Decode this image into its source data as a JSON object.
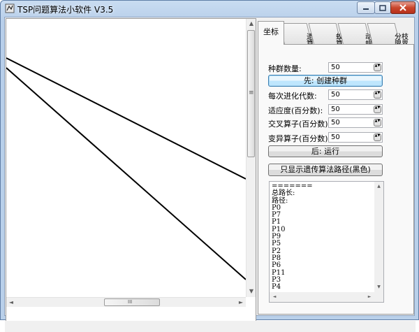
{
  "window": {
    "title": "TSP问题算法小软件 V3.5",
    "icons": {
      "app": "app-icon",
      "minimize": "minimize-icon",
      "maximize": "maximize-icon",
      "close": "close-icon"
    }
  },
  "canvas": {
    "scroll": {
      "up": "▲",
      "down": "▼",
      "left": "◄",
      "right": "►",
      "vgrip": "≡",
      "hgrip": "III"
    }
  },
  "tabs": [
    {
      "label": "坐标",
      "active": true
    },
    {
      "label": "遗传\n算法",
      "active": false
    },
    {
      "label": "蚁群\n算法",
      "active": false
    },
    {
      "label": "动态\n规划",
      "active": false
    },
    {
      "label": "分枝\n限界",
      "active": false
    }
  ],
  "ga": {
    "population_label": "种群数量:",
    "population_value": "50",
    "create_button": "先: 创建种群",
    "generations_label": "每次进化代数:",
    "generations_value": "50",
    "fitness_label": "适应度(百分数):",
    "fitness_value": "50",
    "crossover_label": "交叉算子(百分数):",
    "crossover_value": "50",
    "mutation_label": "变异算子(百分数):",
    "mutation_value": "50",
    "run_button": "后: 运行",
    "show_path_button": "只显示遗传算法路径(黑色)",
    "spin_arrows": "▲▼"
  },
  "output": {
    "text": "=======\n总路长:\n路径:\nP0\nP7\nP1\nP10\nP9\nP5\nP2\nP8\nP6\nP11\nP3\nP4"
  }
}
